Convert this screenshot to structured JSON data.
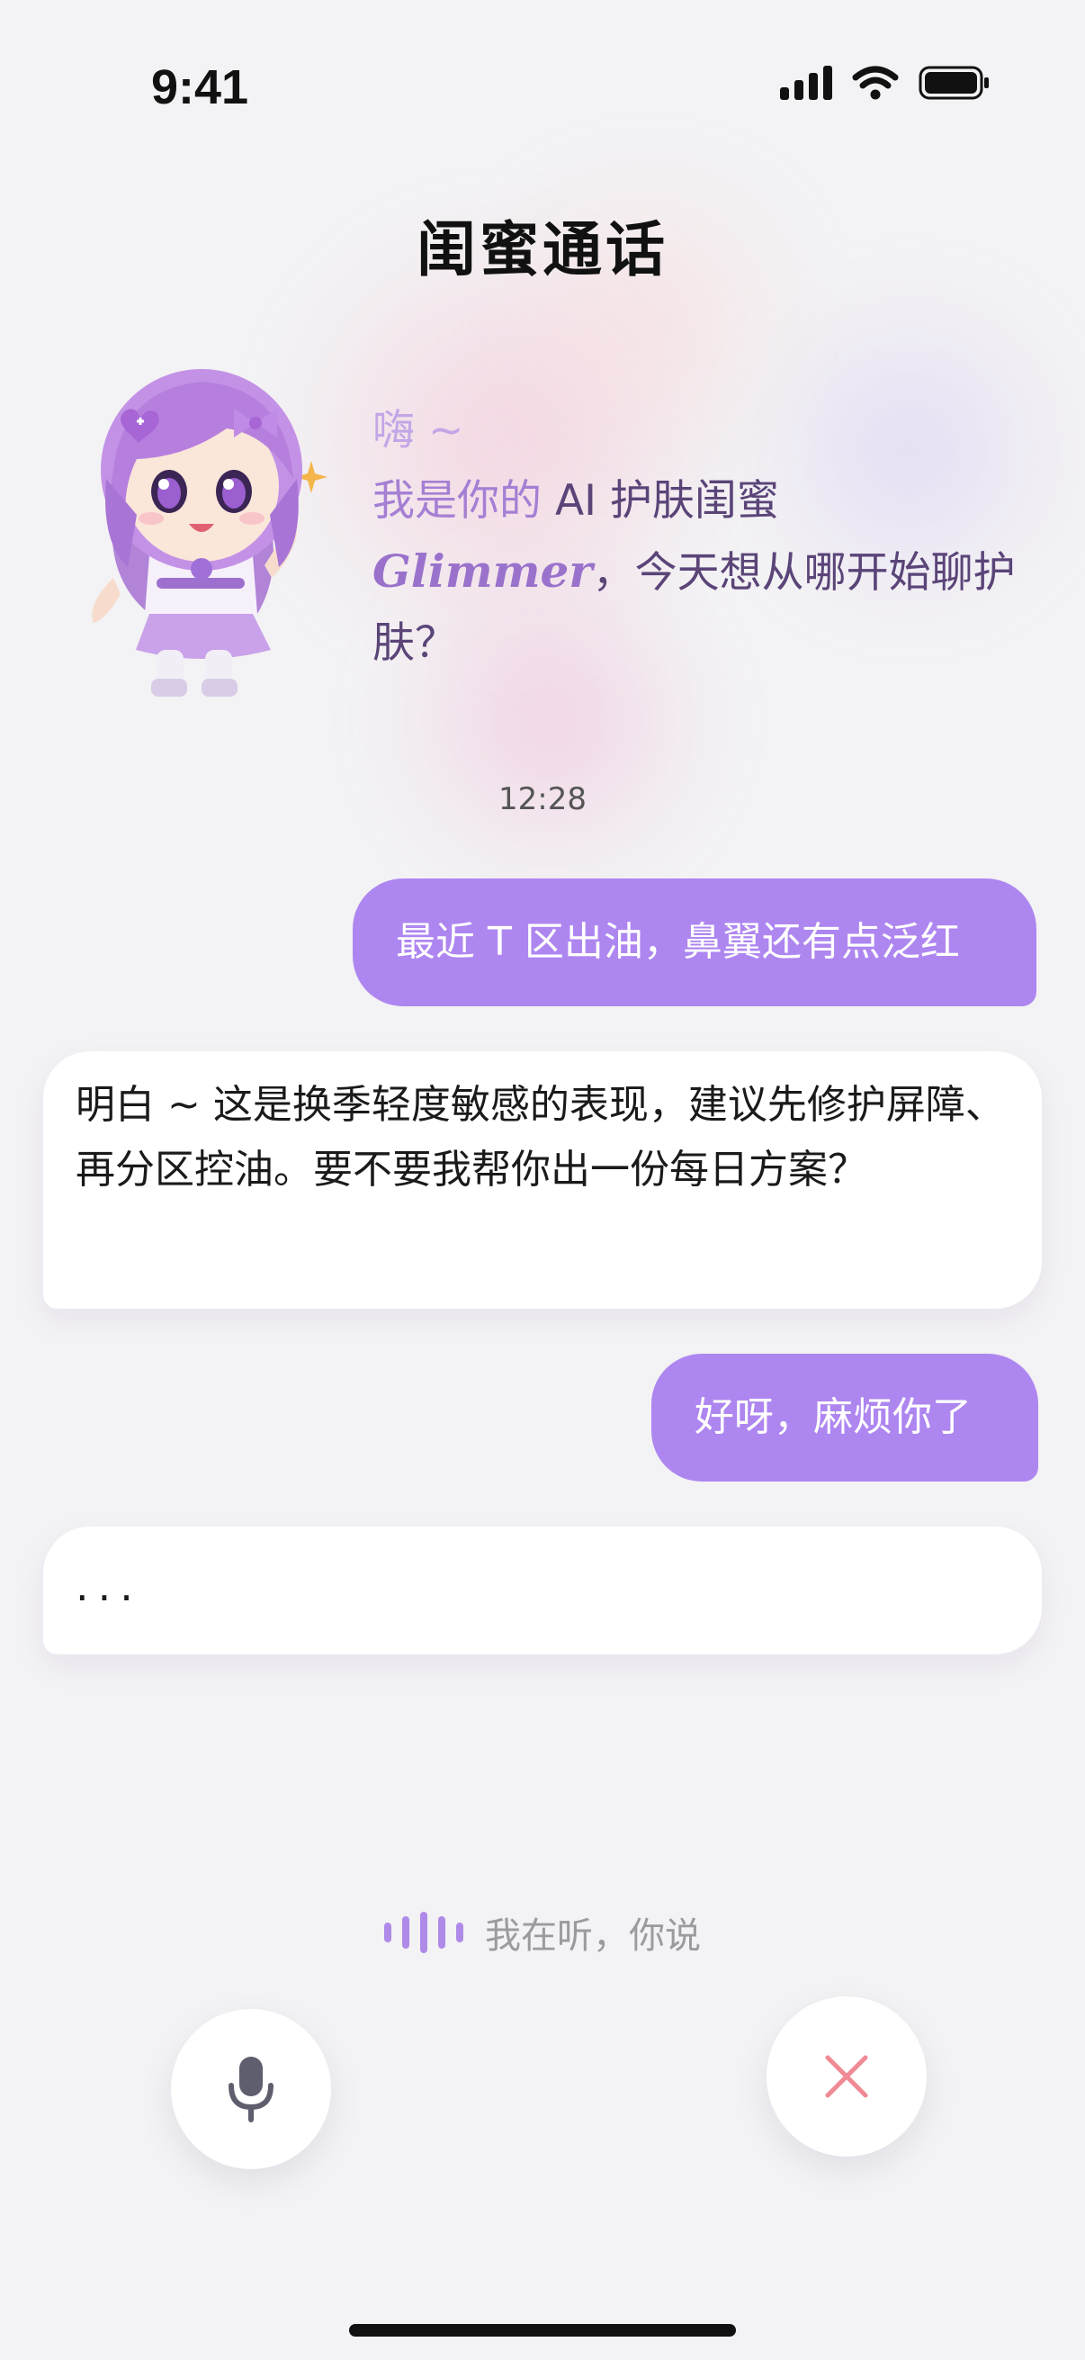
{
  "status_bar": {
    "time": "9:41",
    "icons": [
      "signal-icon",
      "wifi-icon",
      "battery-icon"
    ]
  },
  "header": {
    "title": "闺蜜通话"
  },
  "greeting": {
    "line1": "嗨 ~",
    "line2_prefix": "我是你的",
    "line2_suffix": " AI 护肤闺蜜",
    "brand": "Glimmer",
    "line3_rest": "，今天想从哪开始聊护肤？"
  },
  "chat": {
    "timestamp": "12:28",
    "messages": [
      {
        "from": "user",
        "text": "最近 T 区出油，鼻翼还有点泛红"
      },
      {
        "from": "assistant",
        "text": "明白 ~ 这是换季轻度敏感的表现，建议先修护屏障、再分区控油。要不要我帮你出一份每日方案？"
      },
      {
        "from": "user",
        "text": "好呀，麻烦你了"
      },
      {
        "from": "assistant",
        "text": "..."
      }
    ]
  },
  "listening": {
    "text": "我在听，你说"
  },
  "controls": {
    "mic_icon": "microphone-icon",
    "close_icon": "close-icon"
  },
  "colors": {
    "accent": "#ae86f0",
    "close": "#f08a94",
    "greeting_text": "#5a4478"
  }
}
